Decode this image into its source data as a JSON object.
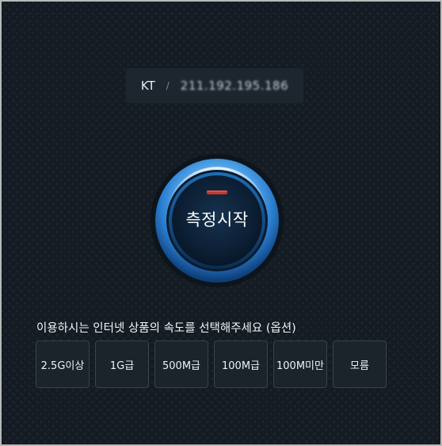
{
  "isp": {
    "name": "KT",
    "separator": "/",
    "ip": "211.192.195.186"
  },
  "start_button": {
    "label": "측정시작"
  },
  "speed_select": {
    "prompt": "이용하시는 인터넷 상품의 속도를 선택해주세요 (옵션)",
    "options": [
      "2.5G이상",
      "1G급",
      "500M급",
      "100M급",
      "100M미만",
      "모름"
    ]
  },
  "colors": {
    "background": "#141b22",
    "accent_blue": "#3fa4f0",
    "indicator_red": "#c0392b"
  }
}
